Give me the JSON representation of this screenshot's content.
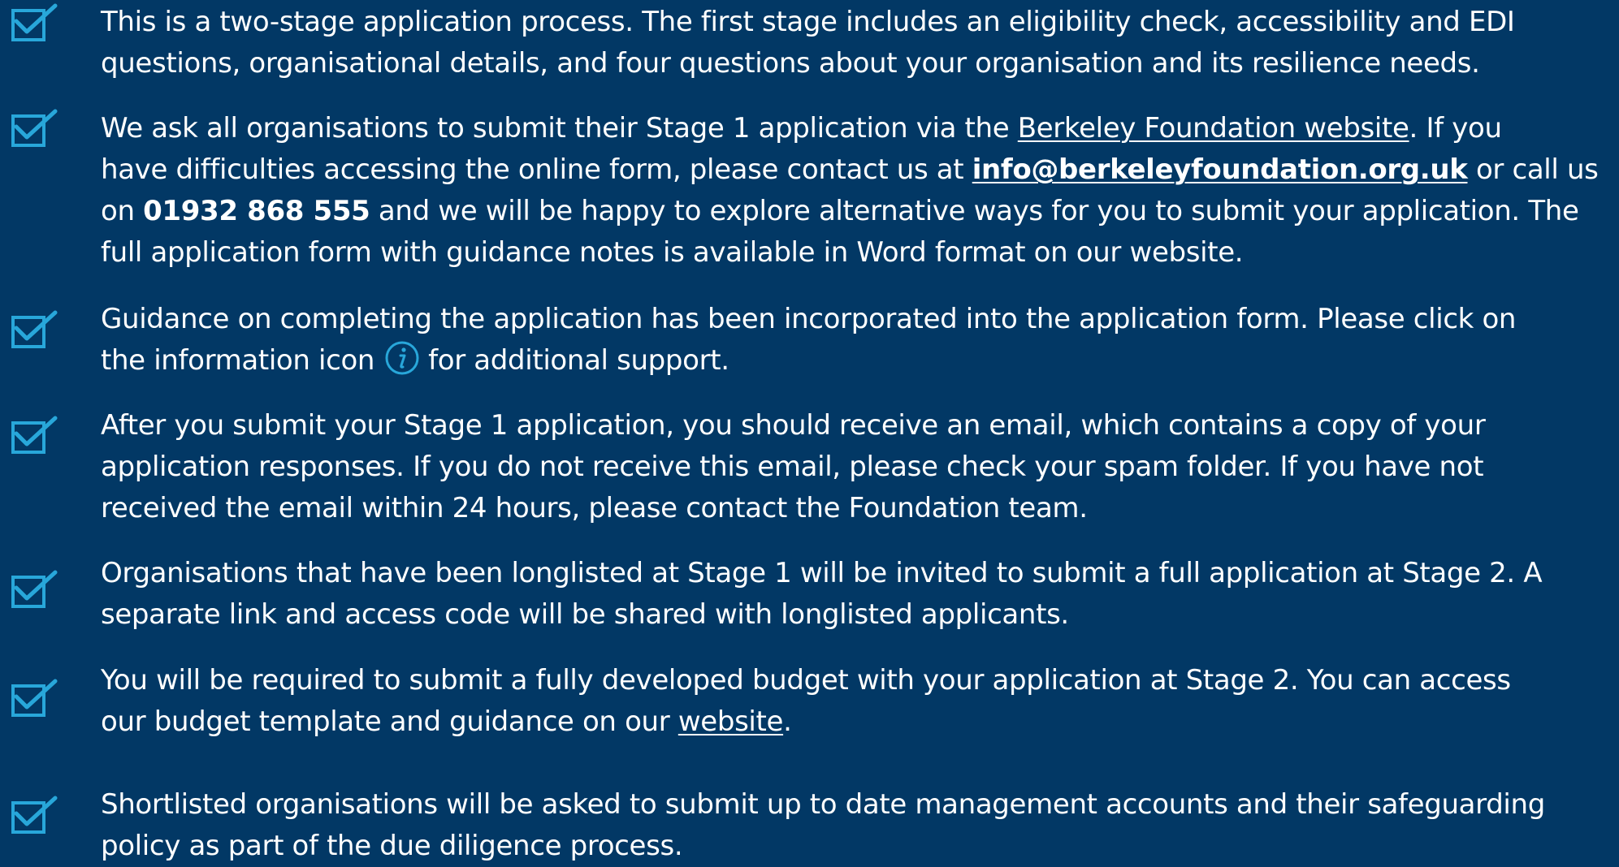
{
  "colors": {
    "background": "#023865",
    "checkbox": "#28a7da",
    "text": "#ffffff"
  },
  "icons": {
    "checkbox": "checked-box-icon",
    "info": "info-circle-icon"
  },
  "items": [
    {
      "lines": [
        "This is a two-stage application process. The first stage includes an eligibility check, accessibility and EDI",
        "questions, organisational details, and four questions about your organisation and its resilience needs."
      ]
    },
    {
      "line1_before": "We ask all organisations to submit their Stage 1 application via the ",
      "link_text": "Berkeley Foundation website",
      "line1_after": ". If you",
      "line2_before": "have difficulties accessing the online form, please contact us at ",
      "email": "info@berkeleyfoundation.org.uk",
      "line2_after": " or call us",
      "line3_before": "on ",
      "phone": "01932 868 555",
      "line3_after": " and we will be happy to explore alternative ways for you to submit your application. The",
      "line4": "full application form with guidance notes is available in Word format on our website."
    },
    {
      "line1": "Guidance on completing the application has been incorporated into the application form. Please click on",
      "line2_before": "the information icon",
      "line2_after": "for additional support."
    },
    {
      "lines": [
        "After you submit your Stage 1 application, you should receive an email, which contains a copy of your",
        "application responses. If you do not receive this email, please check your spam folder. If you have not",
        "received the email within 24 hours, please contact the Foundation team."
      ]
    },
    {
      "lines": [
        "Organisations that have been longlisted at Stage 1 will be invited to submit a full application at Stage 2. A",
        "separate link and access code will be shared with longlisted applicants."
      ]
    },
    {
      "line1": "You will be required to submit a fully developed budget with your application at Stage 2. You can access",
      "line2_before": "our budget template and guidance on our ",
      "link_text": "website",
      "line2_after": "."
    },
    {
      "lines": [
        "Shortlisted organisations will be asked to submit up to date management accounts and their safeguarding",
        "policy as part of the due diligence process."
      ]
    }
  ]
}
